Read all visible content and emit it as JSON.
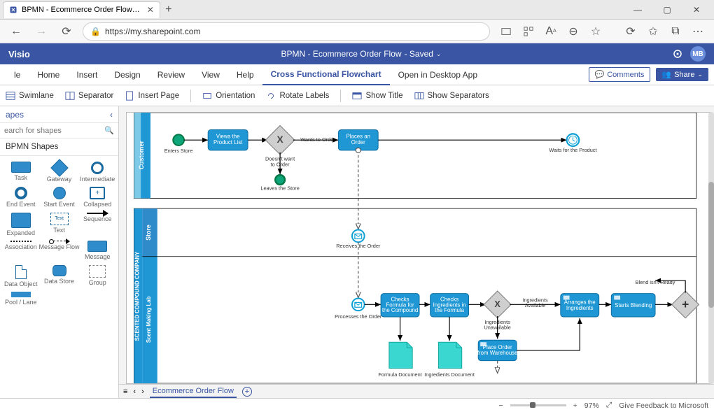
{
  "window": {
    "tab_title": "BPMN - Ecommerce Order Flow…",
    "minimize": "—",
    "maximize": "▢",
    "close": "✕"
  },
  "browser": {
    "url": "https://my.sharepoint.com"
  },
  "visio": {
    "app_name": "Visio",
    "doc_title": "BPMN - Ecommerce Order Flow",
    "save_state": "- Saved",
    "avatar": "MB"
  },
  "ribbon": {
    "tabs": [
      "le",
      "Home",
      "Insert",
      "Design",
      "Review",
      "View",
      "Help",
      "Cross Functional Flowchart"
    ],
    "active_index": 7,
    "open_desktop": "Open in Desktop App",
    "comments": "Comments",
    "share": "Share"
  },
  "sub_ribbon": {
    "items": [
      "Swimlane",
      "Separator",
      "Insert Page",
      "Orientation",
      "Rotate Labels",
      "Show Title",
      "Show Separators"
    ]
  },
  "shapes": {
    "panel_title": "apes",
    "search_placeholder": "earch for shapes",
    "category": "BPMN Shapes",
    "items": [
      "Task",
      "Gateway",
      "Intermediate",
      "End Event",
      "Start Event",
      "Collapsed",
      "Expanded",
      "Text",
      "Sequence",
      "Association",
      "Message Flow",
      "Message",
      "Data Object",
      "Data Store",
      "Group",
      "Pool / Lane"
    ]
  },
  "canvas": {
    "lanes": {
      "customer": "Customer",
      "store": "Store",
      "scent_lab": "Scent Making Lab",
      "company": "SCENTED COMPOUND COMPANY"
    },
    "activities": {
      "views_product": "Views the\nProduct List",
      "places_order": "Places an\nOrder",
      "checks_formula": "Checks\nFormula for\nthe Compound",
      "checks_ingredients": "Checks\nIngredients in\nthe Formula",
      "arranges_ingredients": "Arranges the\nIngredients",
      "starts_blending": "Starts Blending",
      "place_order_wh": "Place Order\nfrom Warehouse"
    },
    "labels": {
      "enters_store": "Enters Store",
      "leaves_store": "Leaves the Store",
      "wants_order": "Wants to Order",
      "doesnt_want": "Doesn't want\nto Order",
      "waits_product": "Waits for the Product",
      "receives_order": "Receives the Order",
      "processes_order": "Processes the Order",
      "ing_avail": "Ingredients\nAvailable",
      "ing_unavail": "Ingredients\nUnavailable",
      "blend_not_ready": "Blend isn't Ready",
      "formula_doc": "Formula Document",
      "ingredients_doc": "Ingredients Document"
    }
  },
  "page_tabs": {
    "active": "Ecommerce Order Flow"
  },
  "status": {
    "zoom": "97%",
    "feedback": "Give Feedback to Microsoft"
  }
}
